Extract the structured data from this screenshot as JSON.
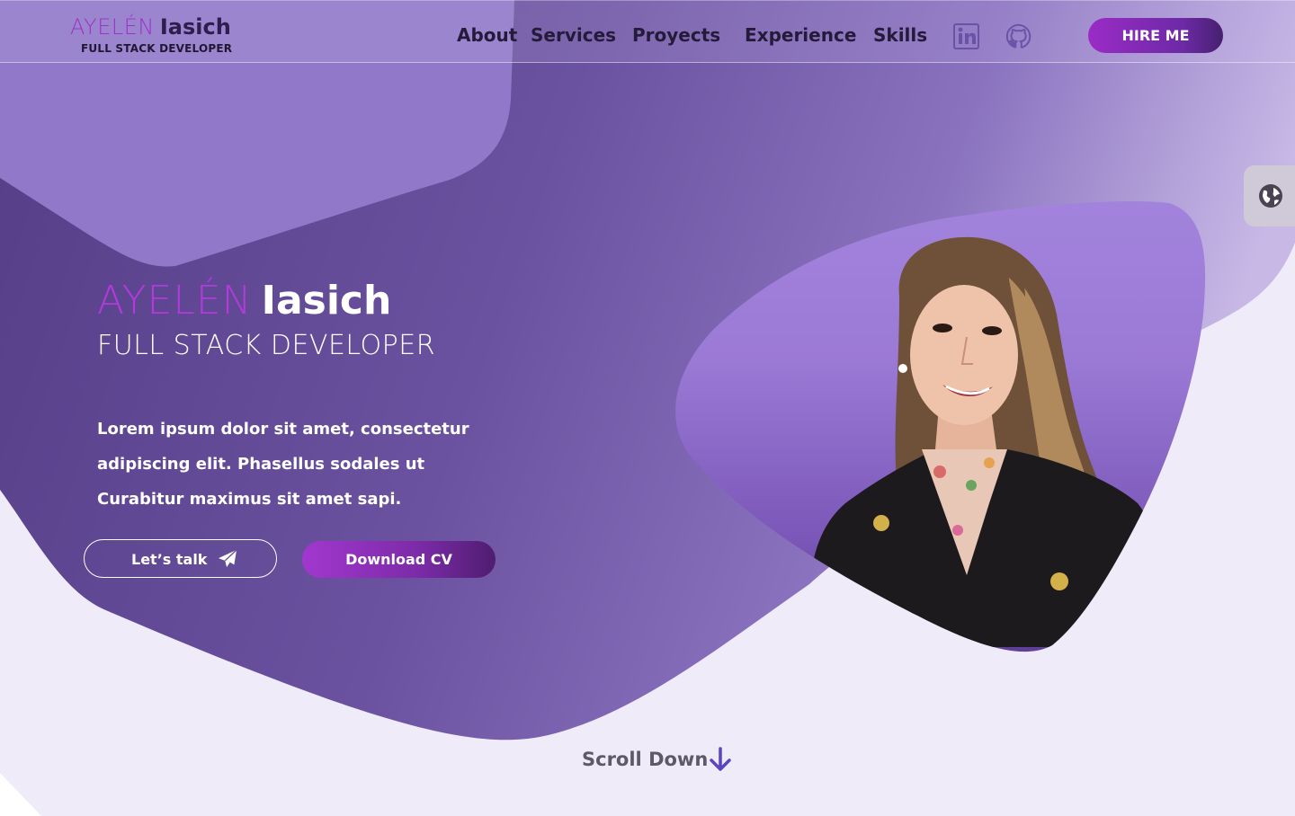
{
  "header": {
    "brand_first": "AYELÉN",
    "brand_last": "Iasich",
    "brand_subtitle": "FULL STACK DEVELOPER",
    "nav": [
      "About",
      "Services",
      "Proyects",
      "Experience",
      "Skills"
    ],
    "social_icons": [
      "linkedin-icon",
      "github-icon"
    ],
    "hire_label": "HIRE ME"
  },
  "language_toggle": {
    "icon": "globe-icon"
  },
  "hero": {
    "name_first": "AYELÉN",
    "name_last": "Iasich",
    "title": "FULL STACK DEVELOPER",
    "text_lines": [
      "Lorem ipsum dolor sit amet, consectetur",
      "adipiscing elit. Phasellus sodales ut",
      "Curabitur maximus sit amet sapi."
    ],
    "talk_label": "Let’s talk",
    "talk_icon": "paper-plane-icon",
    "cv_label": "Download CV"
  },
  "scroll": {
    "label": "Scroll Down",
    "icon": "arrow-down-icon"
  },
  "colors": {
    "accent": "#9d33c6",
    "hero_bg": "#6b4f9e",
    "page_bg": "#efebf9",
    "blob_light": "#a78be0"
  }
}
